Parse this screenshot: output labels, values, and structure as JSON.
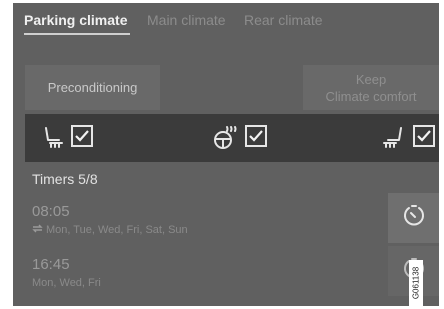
{
  "tabs": [
    {
      "label": "Parking climate",
      "active": true
    },
    {
      "label": "Main climate",
      "active": false
    },
    {
      "label": "Rear climate",
      "active": false
    }
  ],
  "buttons": {
    "preconditioning": "Preconditioning",
    "keep_line1": "Keep",
    "keep_line2": "Climate comfort"
  },
  "options": [
    {
      "icon": "heated-seat-icon",
      "checked": true
    },
    {
      "icon": "heated-steering-wheel-icon",
      "checked": true
    },
    {
      "icon": "heated-rear-seat-icon",
      "checked": true
    }
  ],
  "timers": {
    "title": "Timers 5/8",
    "items": [
      {
        "time": "08:05",
        "days": "Mon, Tue, Wed, Fri, Sat, Sun",
        "repeat": true
      },
      {
        "time": "16:45",
        "days": "Mon, Wed, Fri",
        "repeat": false
      }
    ]
  },
  "image_code": "G061138",
  "colors": {
    "screen_bg": "#606060",
    "strip_bg": "#3b3b3b",
    "button_bg": "#696969"
  }
}
